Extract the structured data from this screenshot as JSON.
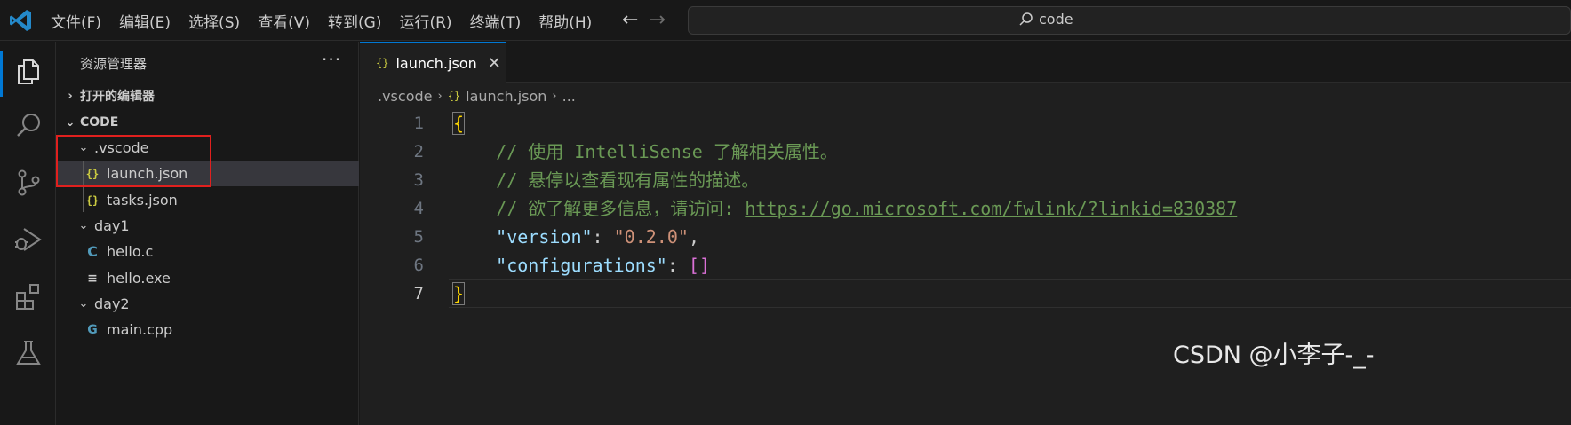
{
  "titlebar": {
    "menu": [
      "文件(F)",
      "编辑(E)",
      "选择(S)",
      "查看(V)",
      "转到(G)",
      "运行(R)",
      "终端(T)",
      "帮助(H)"
    ],
    "back_icon": "arrow-left-icon",
    "forward_icon": "arrow-right-icon",
    "search_text": "code"
  },
  "activity_bar": {
    "icons": [
      "explorer-icon",
      "search-icon",
      "source-control-icon",
      "run-debug-icon",
      "extensions-icon",
      "testing-icon"
    ],
    "active": "explorer-icon",
    "accent": "#0078d4"
  },
  "sidebar": {
    "title": "资源管理器",
    "more": "···",
    "open_editors": "打开的编辑器",
    "folder": "CODE",
    "tree": [
      {
        "label": ".vscode",
        "type": "folder",
        "expanded": true
      },
      {
        "label": "launch.json",
        "type": "json",
        "icon_text": "{}",
        "selected": true
      },
      {
        "label": "tasks.json",
        "type": "json",
        "icon_text": "{}"
      },
      {
        "label": "day1",
        "type": "folder",
        "expanded": true
      },
      {
        "label": "hello.c",
        "type": "c",
        "icon_text": "C"
      },
      {
        "label": "hello.exe",
        "type": "exe",
        "icon_text": "≡"
      },
      {
        "label": "day2",
        "type": "folder",
        "expanded": true
      },
      {
        "label": "main.cpp",
        "type": "cpp",
        "icon_text": "G"
      }
    ]
  },
  "editor": {
    "tab": {
      "icon_text": "{}",
      "label": "launch.json",
      "close": "✕"
    },
    "breadcrumb": [
      ".vscode",
      "launch.json",
      "..."
    ],
    "breadcrumb_icon_text": "{}",
    "lines": [
      {
        "n": "1",
        "parts": [
          {
            "t": "{",
            "c": "brace"
          }
        ]
      },
      {
        "n": "2",
        "parts": [
          {
            "t": "    // 使用 IntelliSense 了解相关属性。",
            "c": "comment"
          }
        ]
      },
      {
        "n": "3",
        "parts": [
          {
            "t": "    // 悬停以查看现有属性的描述。",
            "c": "comment"
          }
        ]
      },
      {
        "n": "4",
        "parts": [
          {
            "t": "    // 欲了解更多信息，请访问: ",
            "c": "comment"
          },
          {
            "t": "https://go.microsoft.com/fwlink/?linkid=830387",
            "c": "link"
          }
        ]
      },
      {
        "n": "5",
        "parts": [
          {
            "t": "    ",
            "c": "punc"
          },
          {
            "t": "\"version\"",
            "c": "key"
          },
          {
            "t": ": ",
            "c": "punc"
          },
          {
            "t": "\"0.2.0\"",
            "c": "str"
          },
          {
            "t": ",",
            "c": "punc"
          }
        ]
      },
      {
        "n": "6",
        "parts": [
          {
            "t": "    ",
            "c": "punc"
          },
          {
            "t": "\"configurations\"",
            "c": "key"
          },
          {
            "t": ": ",
            "c": "punc"
          },
          {
            "t": "[]",
            "c": "bracket2"
          }
        ]
      },
      {
        "n": "7",
        "parts": [
          {
            "t": "}",
            "c": "brace"
          }
        ],
        "current": true
      }
    ]
  },
  "watermark": "CSDN @小李子-_-"
}
